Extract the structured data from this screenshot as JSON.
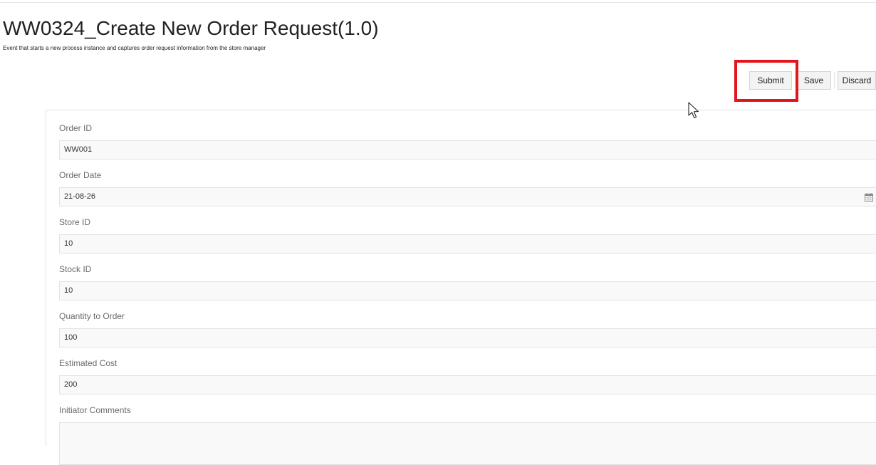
{
  "page": {
    "title": "WW0324_Create New Order Request(1.0)",
    "description": "Event that starts a new process instance and captures order request information from the store manager"
  },
  "actions": {
    "submit_label": "Submit",
    "save_label": "Save",
    "discard_label": "Discard",
    "highlighted": "Submit",
    "highlight_color": "#e3141c"
  },
  "form": {
    "fields": [
      {
        "label": "Order ID",
        "value": "WW001",
        "type": "text"
      },
      {
        "label": "Order Date",
        "value": "21-08-26",
        "type": "date",
        "icon": "calendar-icon"
      },
      {
        "label": "Store ID",
        "value": "10",
        "type": "text"
      },
      {
        "label": "Stock ID",
        "value": "10",
        "type": "text"
      },
      {
        "label": "Quantity to Order",
        "value": "100",
        "type": "text"
      },
      {
        "label": "Estimated Cost",
        "value": "200",
        "type": "text"
      },
      {
        "label": "Initiator Comments",
        "value": "",
        "type": "textarea"
      }
    ]
  },
  "colors": {
    "input_background": "#f9f9f9",
    "input_border": "#e3e3e3",
    "label_text": "#6b6b6b"
  }
}
